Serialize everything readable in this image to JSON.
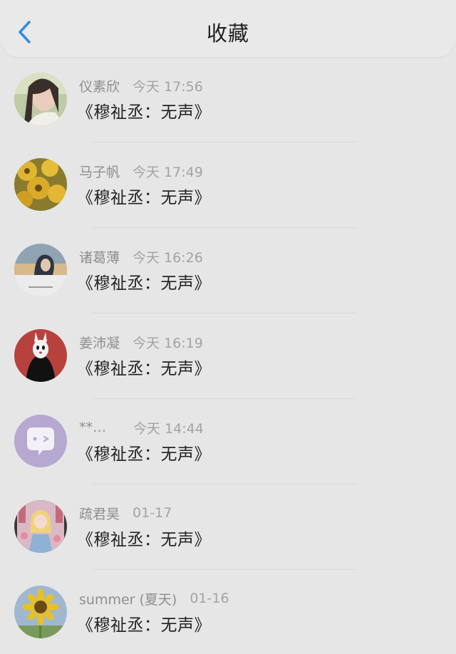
{
  "header": {
    "title": "收藏"
  },
  "items": [
    {
      "sender": "仪素欣",
      "time": "今天 17:56",
      "content": "《穆祉丞：无声》"
    },
    {
      "sender": "马子帆",
      "time": "今天 17:49",
      "content": "《穆祉丞：无声》"
    },
    {
      "sender": "诸葛薄",
      "time": "今天 16:26",
      "content": "《穆祉丞：无声》"
    },
    {
      "sender": "姜沛凝",
      "time": "今天 16:19",
      "content": "《穆祉丞：无声》"
    },
    {
      "sender": "**…",
      "time": "今天 14:44",
      "content": "《穆祉丞：无声》"
    },
    {
      "sender": "疏君昊",
      "time": "01-17",
      "content": "《穆祉丞：无声》"
    },
    {
      "sender": "summer (夏天)",
      "time": "01-16",
      "content": "《穆祉丞：无声》"
    }
  ],
  "colors": {
    "accent": "#2f8fe0",
    "background": "#e6e6e6"
  },
  "icons": {
    "back": "chevron-left-icon"
  }
}
